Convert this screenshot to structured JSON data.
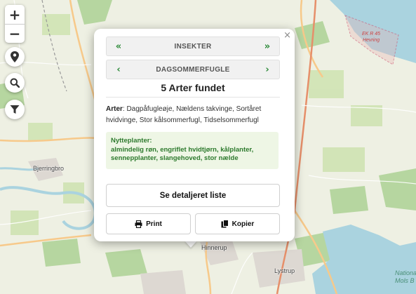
{
  "map": {
    "places": [
      "Bjerringbro",
      "Hinnerup",
      "Lystrup"
    ],
    "zone_label_line1": "EK R 45",
    "zone_label_line2": "Hevring",
    "park_label_line1": "Nationa",
    "park_label_line2": "Mols B"
  },
  "controls": {
    "zoom_in": "+",
    "zoom_out": "−",
    "location_icon": "map-pin-icon",
    "search_icon": "search-icon",
    "filter_icon": "filter-icon"
  },
  "popup": {
    "close": "×",
    "category": {
      "label": "INSEKTER",
      "prev": "«",
      "next": "»"
    },
    "subcategory": {
      "label": "DAGSOMMERFUGLE",
      "prev": "‹",
      "next": "›"
    },
    "heading": "5 Arter fundet",
    "arter_label": "Arter",
    "arter_text": ": Dagpåfugleøje, Nældens takvinge, Sortåret hvidvinge, Stor kålsommerfugl, Tidselsommerfugl",
    "nytteplanter_label": "Nytteplanter:",
    "nytteplanter_text": "almindelig røn, engriflet hvidtjørn, kålplanter, sennepplanter, slangehoved, stor nælde",
    "detail_button": "Se detaljeret liste",
    "print_button": "Print",
    "copy_button": "Kopier"
  },
  "colors": {
    "accent_green": "#2e8b3a",
    "water": "#aad3df",
    "forest": "#add19e",
    "road": "#f7c98a"
  }
}
